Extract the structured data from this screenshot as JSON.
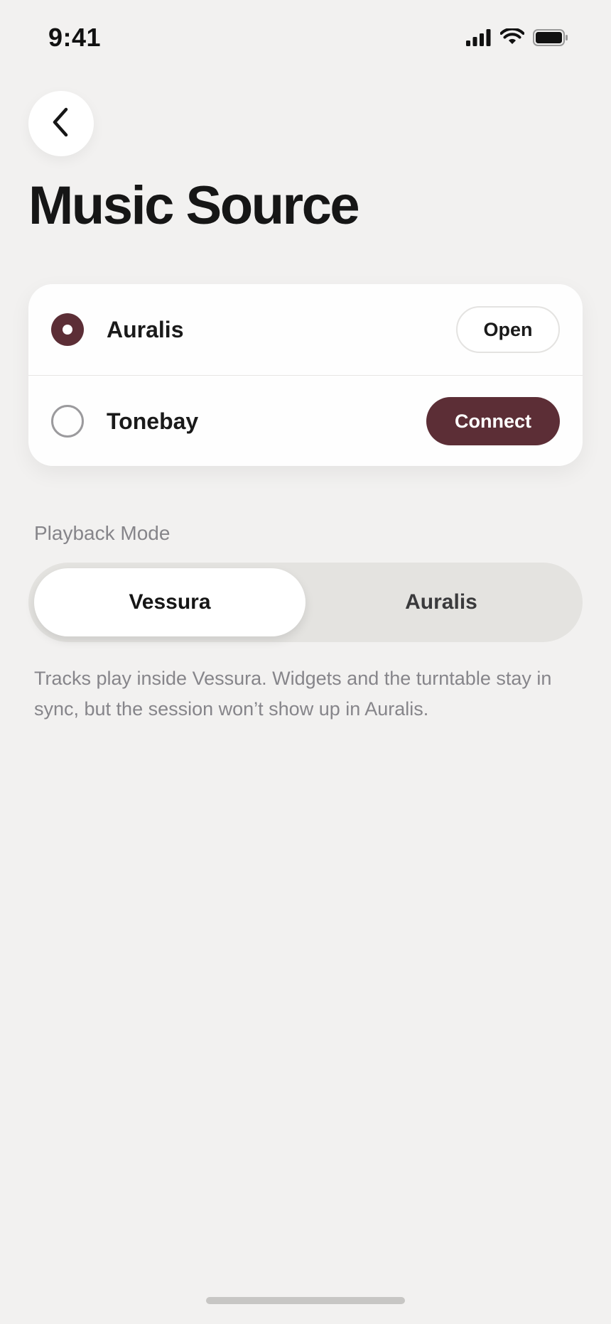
{
  "status_bar": {
    "time": "9:41",
    "icons": [
      "cellular-signal-icon",
      "wifi-icon",
      "battery-icon"
    ]
  },
  "header": {
    "back_icon": "chevron-left-icon",
    "title": "Music Source"
  },
  "sources": [
    {
      "name": "Auralis",
      "selected": true,
      "action_label": "Open"
    },
    {
      "name": "Tonebay",
      "selected": false,
      "action_label": "Connect"
    }
  ],
  "playback": {
    "label": "Playback Mode",
    "options": [
      "Vessura",
      "Auralis"
    ],
    "selected_option": "Vessura",
    "description": "Tracks play inside Vessura. Widgets and the turntable stay in sync, but the session won’t show up in Auralis."
  },
  "colors": {
    "accent": "#5c2e36",
    "background": "#f2f1f0",
    "card": "#fefefe",
    "secondary_text": "#86858a"
  }
}
